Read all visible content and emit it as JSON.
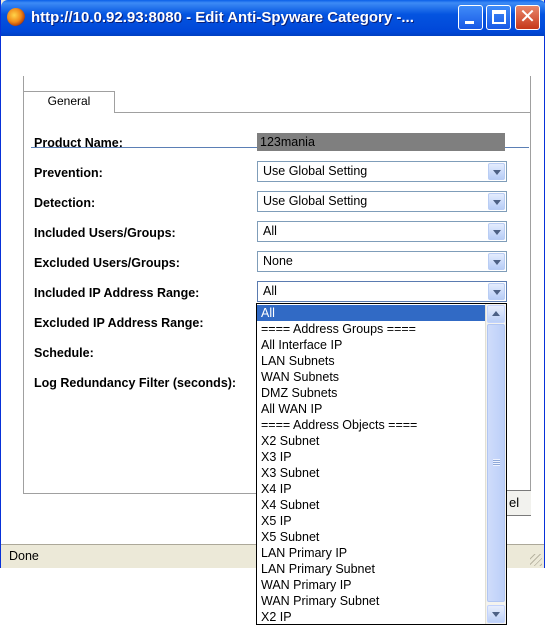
{
  "window": {
    "title": "http://10.0.92.93:8080 - Edit Anti-Spyware Category -...",
    "icon": "firefox-icon"
  },
  "tabs": [
    {
      "label": "General"
    }
  ],
  "form": {
    "product_name": {
      "label": "Product Name:",
      "value": "123mania"
    },
    "prevention": {
      "label": "Prevention:",
      "value": "Use Global Setting"
    },
    "detection": {
      "label": "Detection:",
      "value": "Use Global Setting"
    },
    "included_users": {
      "label": "Included Users/Groups:",
      "value": "All"
    },
    "excluded_users": {
      "label": "Excluded Users/Groups:",
      "value": "None"
    },
    "included_ip": {
      "label": "Included IP Address Range:",
      "value": "All"
    },
    "excluded_ip": {
      "label": "Excluded IP Address Range:"
    },
    "schedule": {
      "label": "Schedule:"
    },
    "log_filter": {
      "label": "Log Redundancy Filter (seconds):"
    }
  },
  "partial_button": {
    "label": "el"
  },
  "dropdown": {
    "selected_index": 0,
    "options": [
      "All",
      "==== Address Groups ====",
      "All Interface IP",
      "LAN Subnets",
      "WAN Subnets",
      "DMZ Subnets",
      "All WAN IP",
      "==== Address Objects ====",
      "X2 Subnet",
      "X3 IP",
      "X3 Subnet",
      "X4 IP",
      "X4 Subnet",
      "X5 IP",
      "X5 Subnet",
      "LAN Primary IP",
      "LAN Primary Subnet",
      "WAN Primary IP",
      "WAN Primary Subnet",
      "X2 IP"
    ]
  },
  "status": {
    "text": "Done"
  },
  "colors": {
    "titlebar": "#0454e0",
    "selection": "#316ac5",
    "readonly_field": "#7f7f7f"
  }
}
